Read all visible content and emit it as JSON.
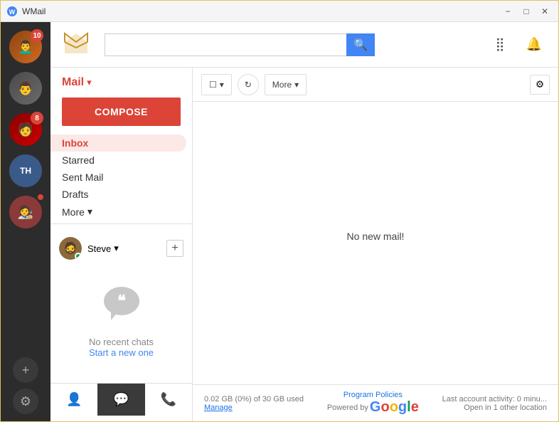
{
  "window": {
    "title": "WMail",
    "controls": {
      "minimize": "−",
      "maximize": "□",
      "close": "✕"
    }
  },
  "header": {
    "logo": "✈",
    "search_placeholder": "",
    "search_icon": "🔍",
    "apps_icon": "⋮⋮⋮",
    "bell_icon": "🔔"
  },
  "mail_nav": {
    "section_label": "Mail",
    "dropdown": "▾",
    "compose_label": "COMPOSE",
    "items": [
      {
        "label": "Inbox",
        "active": true
      },
      {
        "label": "Starred"
      },
      {
        "label": "Sent Mail"
      },
      {
        "label": "Drafts"
      },
      {
        "label": "More",
        "has_arrow": true
      }
    ]
  },
  "toolbar": {
    "select_label": "□",
    "select_arrow": "▾",
    "refresh_label": "↻",
    "more_label": "More",
    "more_arrow": "▾",
    "settings_icon": "⚙"
  },
  "main_content": {
    "no_mail_message": "No new mail!",
    "storage_text": "0.02 GB (0%) of 30 GB used",
    "manage_link": "Manage",
    "powered_by": "Powered by",
    "google_letters": [
      "G",
      "o",
      "o",
      "g",
      "l",
      "e"
    ],
    "program_policies": "Program Policies",
    "activity_text": "Last account activity: 0 minu...",
    "open_text": "Open in 1 other location"
  },
  "chat": {
    "user_name": "Steve",
    "user_dropdown": "▾",
    "add_icon": "+",
    "no_chats": "No recent chats",
    "start_new": "Start a new one"
  },
  "accounts": [
    {
      "badge": "10",
      "has_badge": true
    },
    {
      "badge": "",
      "has_badge": false
    },
    {
      "badge": "8",
      "has_badge": true
    },
    {
      "badge": "",
      "has_badge": false
    },
    {
      "badge": "",
      "has_badge": false
    },
    {
      "badge": "",
      "has_dot": true
    }
  ],
  "bottom_tabs": [
    {
      "icon": "👤",
      "label": "contacts"
    },
    {
      "icon": "💬",
      "label": "chat",
      "active": true
    },
    {
      "icon": "📞",
      "label": "phone"
    }
  ],
  "sidebar_bottom": [
    {
      "icon": "+",
      "label": "add-account"
    },
    {
      "icon": "⚙",
      "label": "settings"
    }
  ]
}
